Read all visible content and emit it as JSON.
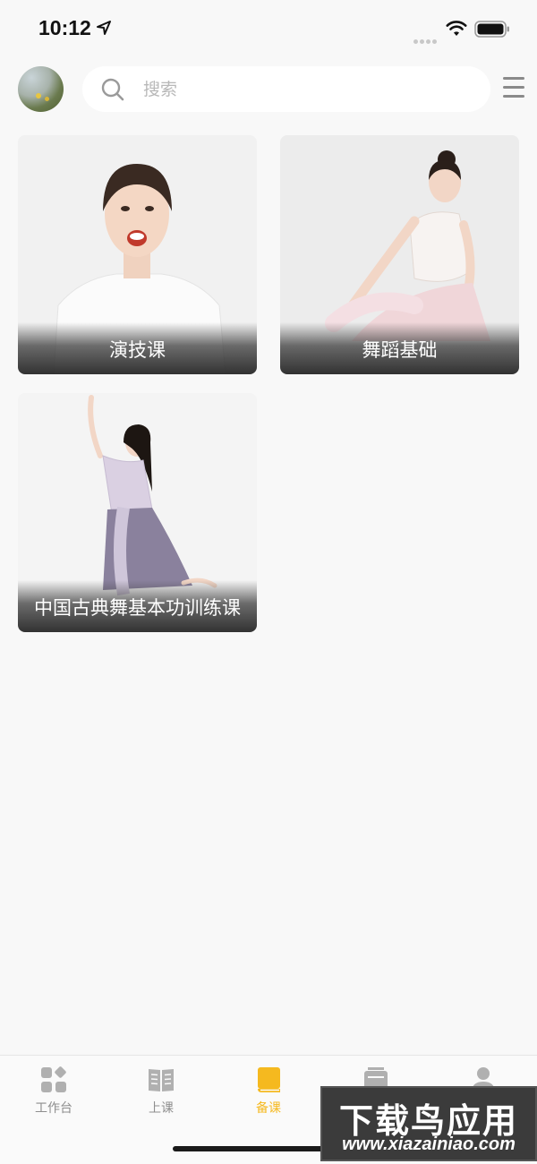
{
  "status_bar": {
    "time": "10:12"
  },
  "header": {
    "search_placeholder": "搜索"
  },
  "courses": [
    {
      "title": "演技课"
    },
    {
      "title": "舞蹈基础"
    },
    {
      "title": "中国古典舞基本功训练课"
    }
  ],
  "tabs": [
    {
      "label": "工作台",
      "icon": "grid-icon",
      "active": false
    },
    {
      "label": "上课",
      "icon": "open-book-icon",
      "active": false
    },
    {
      "label": "备课",
      "icon": "book-icon",
      "active": true
    },
    {
      "label": "",
      "icon": "calendar-icon",
      "active": false
    },
    {
      "label": "",
      "icon": "person-icon",
      "active": false
    }
  ],
  "watermark": {
    "main": "下载鸟应用",
    "sub": "www.xiazainiao.com"
  },
  "colors": {
    "accent": "#f5b91f",
    "background": "#f8f8f8",
    "tab_inactive": "#8e8e8e"
  }
}
